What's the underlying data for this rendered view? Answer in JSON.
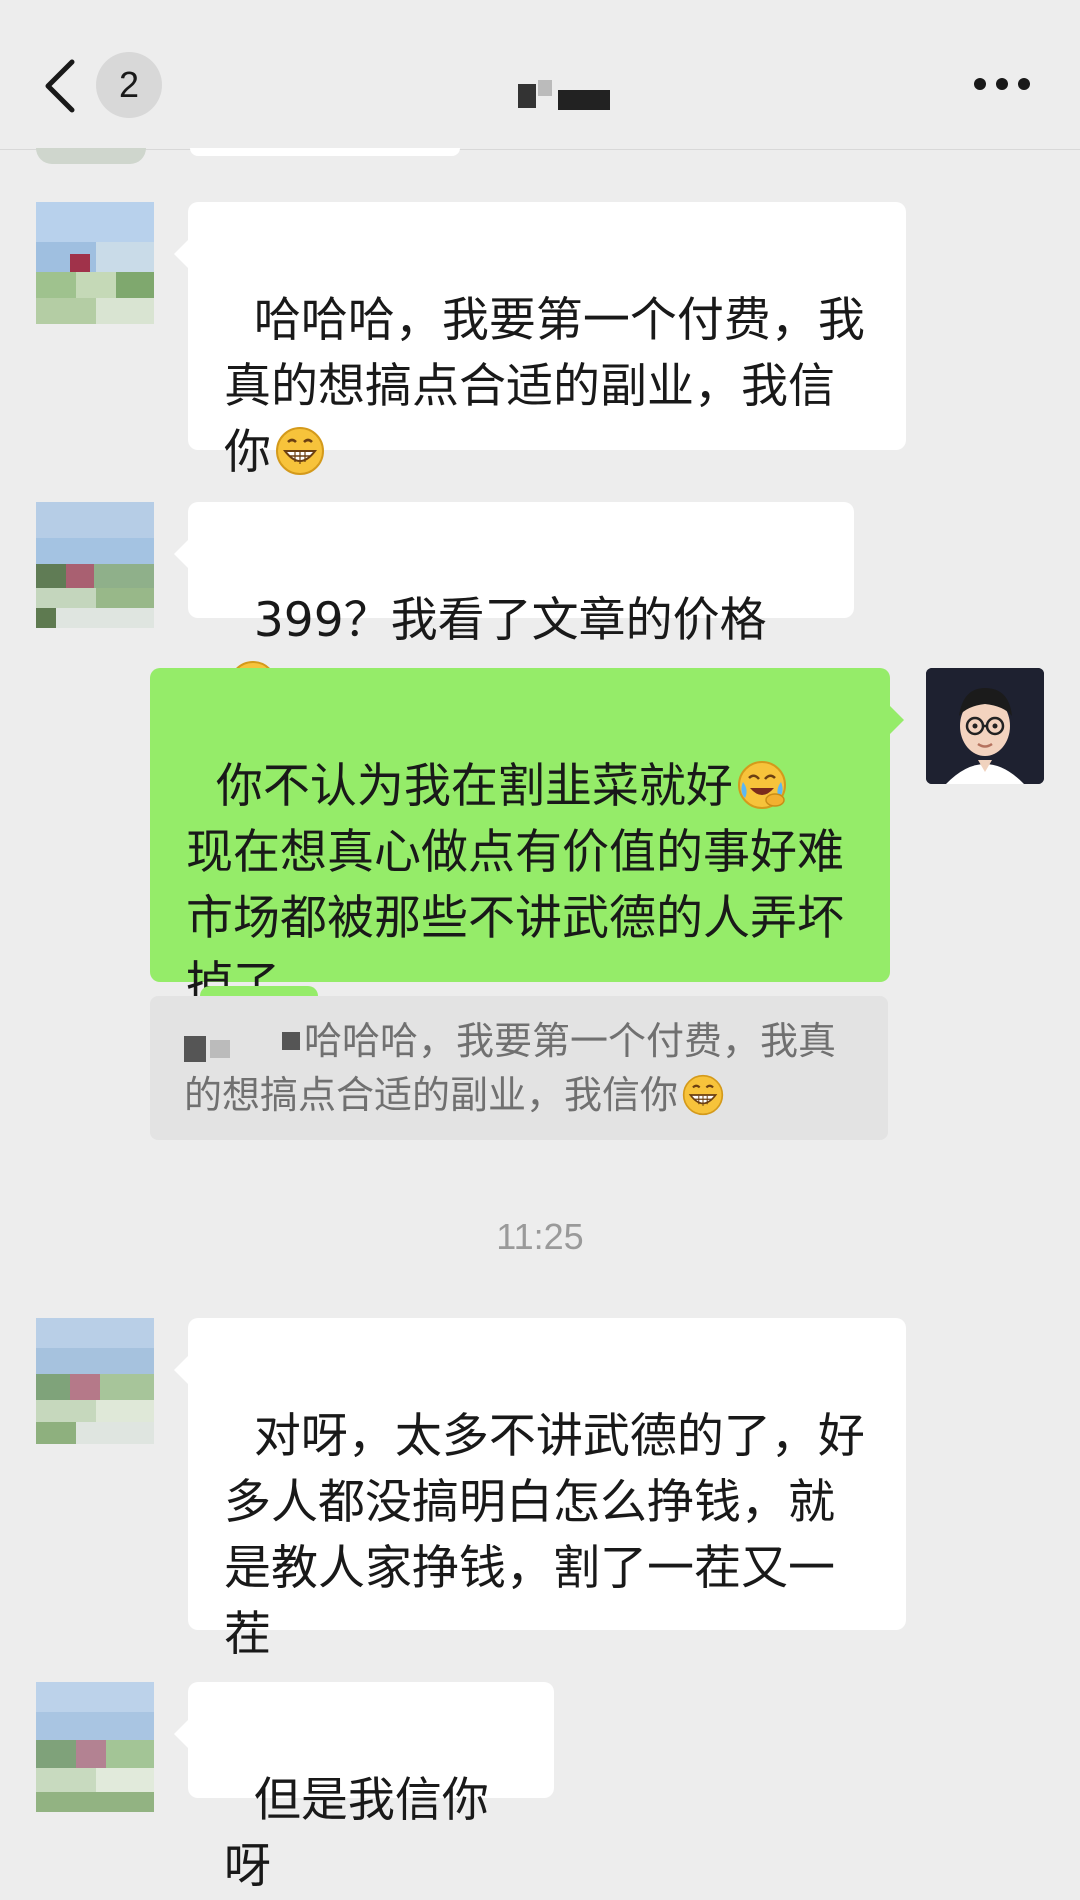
{
  "header": {
    "unread_count": "2"
  },
  "messages": [
    {
      "side": "left",
      "text": "哈哈哈，我要第一个付费，我真的想搞点合适的副业，我信你",
      "emoji": "grinning-face"
    },
    {
      "side": "left",
      "text": "399？我看了文章的价格",
      "emoji": "grinning-face"
    },
    {
      "side": "right",
      "text": "你不认为我在割韭菜就好",
      "text_rest": "现在想真心做点有价值的事好难  市场都被那些不讲武德的人弄坏掉了",
      "emoji": "loudly-laughing-face"
    },
    {
      "side": "left",
      "text": "对呀，太多不讲武德的了，好多人都没搞明白怎么挣钱，就是教人家挣钱，割了一茬又一茬"
    },
    {
      "side": "left",
      "text": "但是我信你呀"
    }
  ],
  "quote": {
    "text": "哈哈哈，我要第一个付费，我真的想搞点合适的副业，我信你",
    "emoji": "grinning-face"
  },
  "timestamp": "11:25",
  "colors": {
    "background": "#ededed",
    "bubble_left": "#ffffff",
    "bubble_right": "#95ec69",
    "quote_bg": "#e3e3e3"
  },
  "icons": {
    "back": "chevron-left-icon",
    "more": "more-dots-icon"
  }
}
